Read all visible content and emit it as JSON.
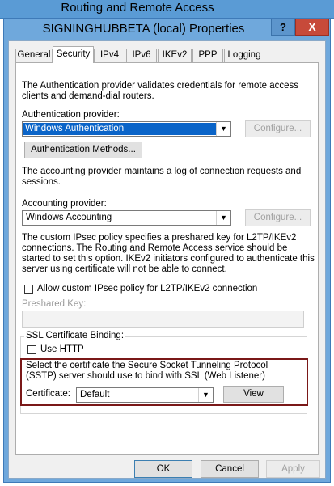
{
  "parent_window": {
    "title": "Routing and Remote Access"
  },
  "dialog": {
    "title": "SIGNINGHUBBETA (local) Properties",
    "help_label": "?",
    "close_label": "X"
  },
  "tabs": [
    {
      "label": "General",
      "active": false
    },
    {
      "label": "Security",
      "active": true
    },
    {
      "label": "IPv4",
      "active": false
    },
    {
      "label": "IPv6",
      "active": false
    },
    {
      "label": "IKEv2",
      "active": false
    },
    {
      "label": "PPP",
      "active": false
    },
    {
      "label": "Logging",
      "active": false
    }
  ],
  "authentication": {
    "description": "The Authentication provider validates credentials for remote access clients and demand-dial routers.",
    "provider_label": "Authentication provider:",
    "provider_value": "Windows Authentication",
    "configure_label": "Configure...",
    "methods_button": "Authentication Methods..."
  },
  "accounting": {
    "description": "The accounting provider maintains a log of connection requests and sessions.",
    "provider_label": "Accounting provider:",
    "provider_value": "Windows Accounting",
    "configure_label": "Configure..."
  },
  "ipsec": {
    "description": "The custom IPsec policy specifies a preshared key for L2TP/IKEv2 connections. The Routing and Remote Access service should be started to set this option. IKEv2 initiators configured to authenticate this server using certificate will not be able to connect.",
    "allow_label": "Allow custom IPsec policy for L2TP/IKEv2 connection",
    "preshared_label": "Preshared Key:"
  },
  "ssl": {
    "group_label": "SSL Certificate Binding:",
    "use_http_label": "Use HTTP",
    "description": "Select the certificate the Secure Socket Tunneling Protocol (SSTP) server should use to bind with SSL (Web Listener)",
    "certificate_label": "Certificate:",
    "certificate_value": "Default",
    "view_label": "View"
  },
  "buttons": {
    "ok": "OK",
    "cancel": "Cancel",
    "apply": "Apply"
  },
  "colors": {
    "highlight_border": "#7a1818",
    "selection": "#0a64c8",
    "titlebar": "#6fa8dc",
    "close": "#c74a3a"
  },
  "icons": {
    "help": "question-icon",
    "close": "close-icon",
    "dropdown": "chevron-down-icon"
  }
}
